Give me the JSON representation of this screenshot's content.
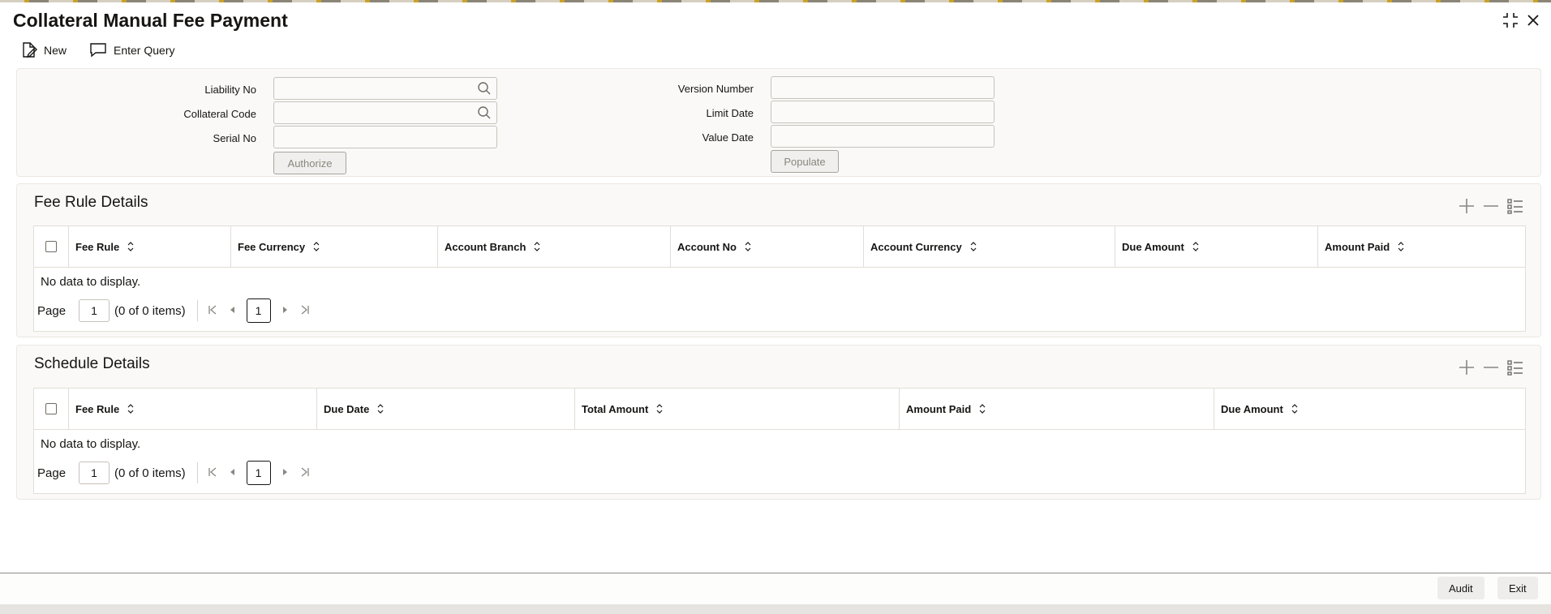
{
  "window": {
    "title": "Collateral Manual Fee Payment"
  },
  "toolbar": {
    "new_label": "New",
    "enter_query_label": "Enter Query"
  },
  "form": {
    "liability_no_label": "Liability No",
    "collateral_code_label": "Collateral Code",
    "serial_no_label": "Serial No",
    "version_number_label": "Version Number",
    "limit_date_label": "Limit Date",
    "value_date_label": "Value Date",
    "liability_no_value": "",
    "collateral_code_value": "",
    "serial_no_value": "",
    "version_number_value": "",
    "limit_date_value": "",
    "value_date_value": "",
    "authorize_label": "Authorize",
    "populate_label": "Populate"
  },
  "fee_rule_details": {
    "title": "Fee Rule Details",
    "columns": [
      "Fee Rule",
      "Fee Currency",
      "Account Branch",
      "Account No",
      "Account Currency",
      "Due Amount",
      "Amount Paid"
    ],
    "rows": [],
    "no_data": "No data to display.",
    "pager": {
      "page_label": "Page",
      "page_value": "1",
      "items_text": "(0 of 0 items)",
      "current_page": "1"
    }
  },
  "schedule_details": {
    "title": "Schedule Details",
    "columns": [
      "Fee Rule",
      "Due Date",
      "Total Amount",
      "Amount Paid",
      "Due Amount"
    ],
    "rows": [],
    "no_data": "No data to display.",
    "pager": {
      "page_label": "Page",
      "page_value": "1",
      "items_text": "(0 of 0 items)",
      "current_page": "1"
    }
  },
  "footer": {
    "audit_label": "Audit",
    "exit_label": "Exit"
  },
  "icons": {
    "new": "new-document-icon",
    "enter_query": "chat-bubble-icon",
    "lov": "search-icon",
    "minimize": "collapse-icon",
    "close": "close-icon",
    "add_row": "plus-icon",
    "delete_row": "minus-icon",
    "single_view": "list-view-icon",
    "sort": "sort-icon"
  }
}
